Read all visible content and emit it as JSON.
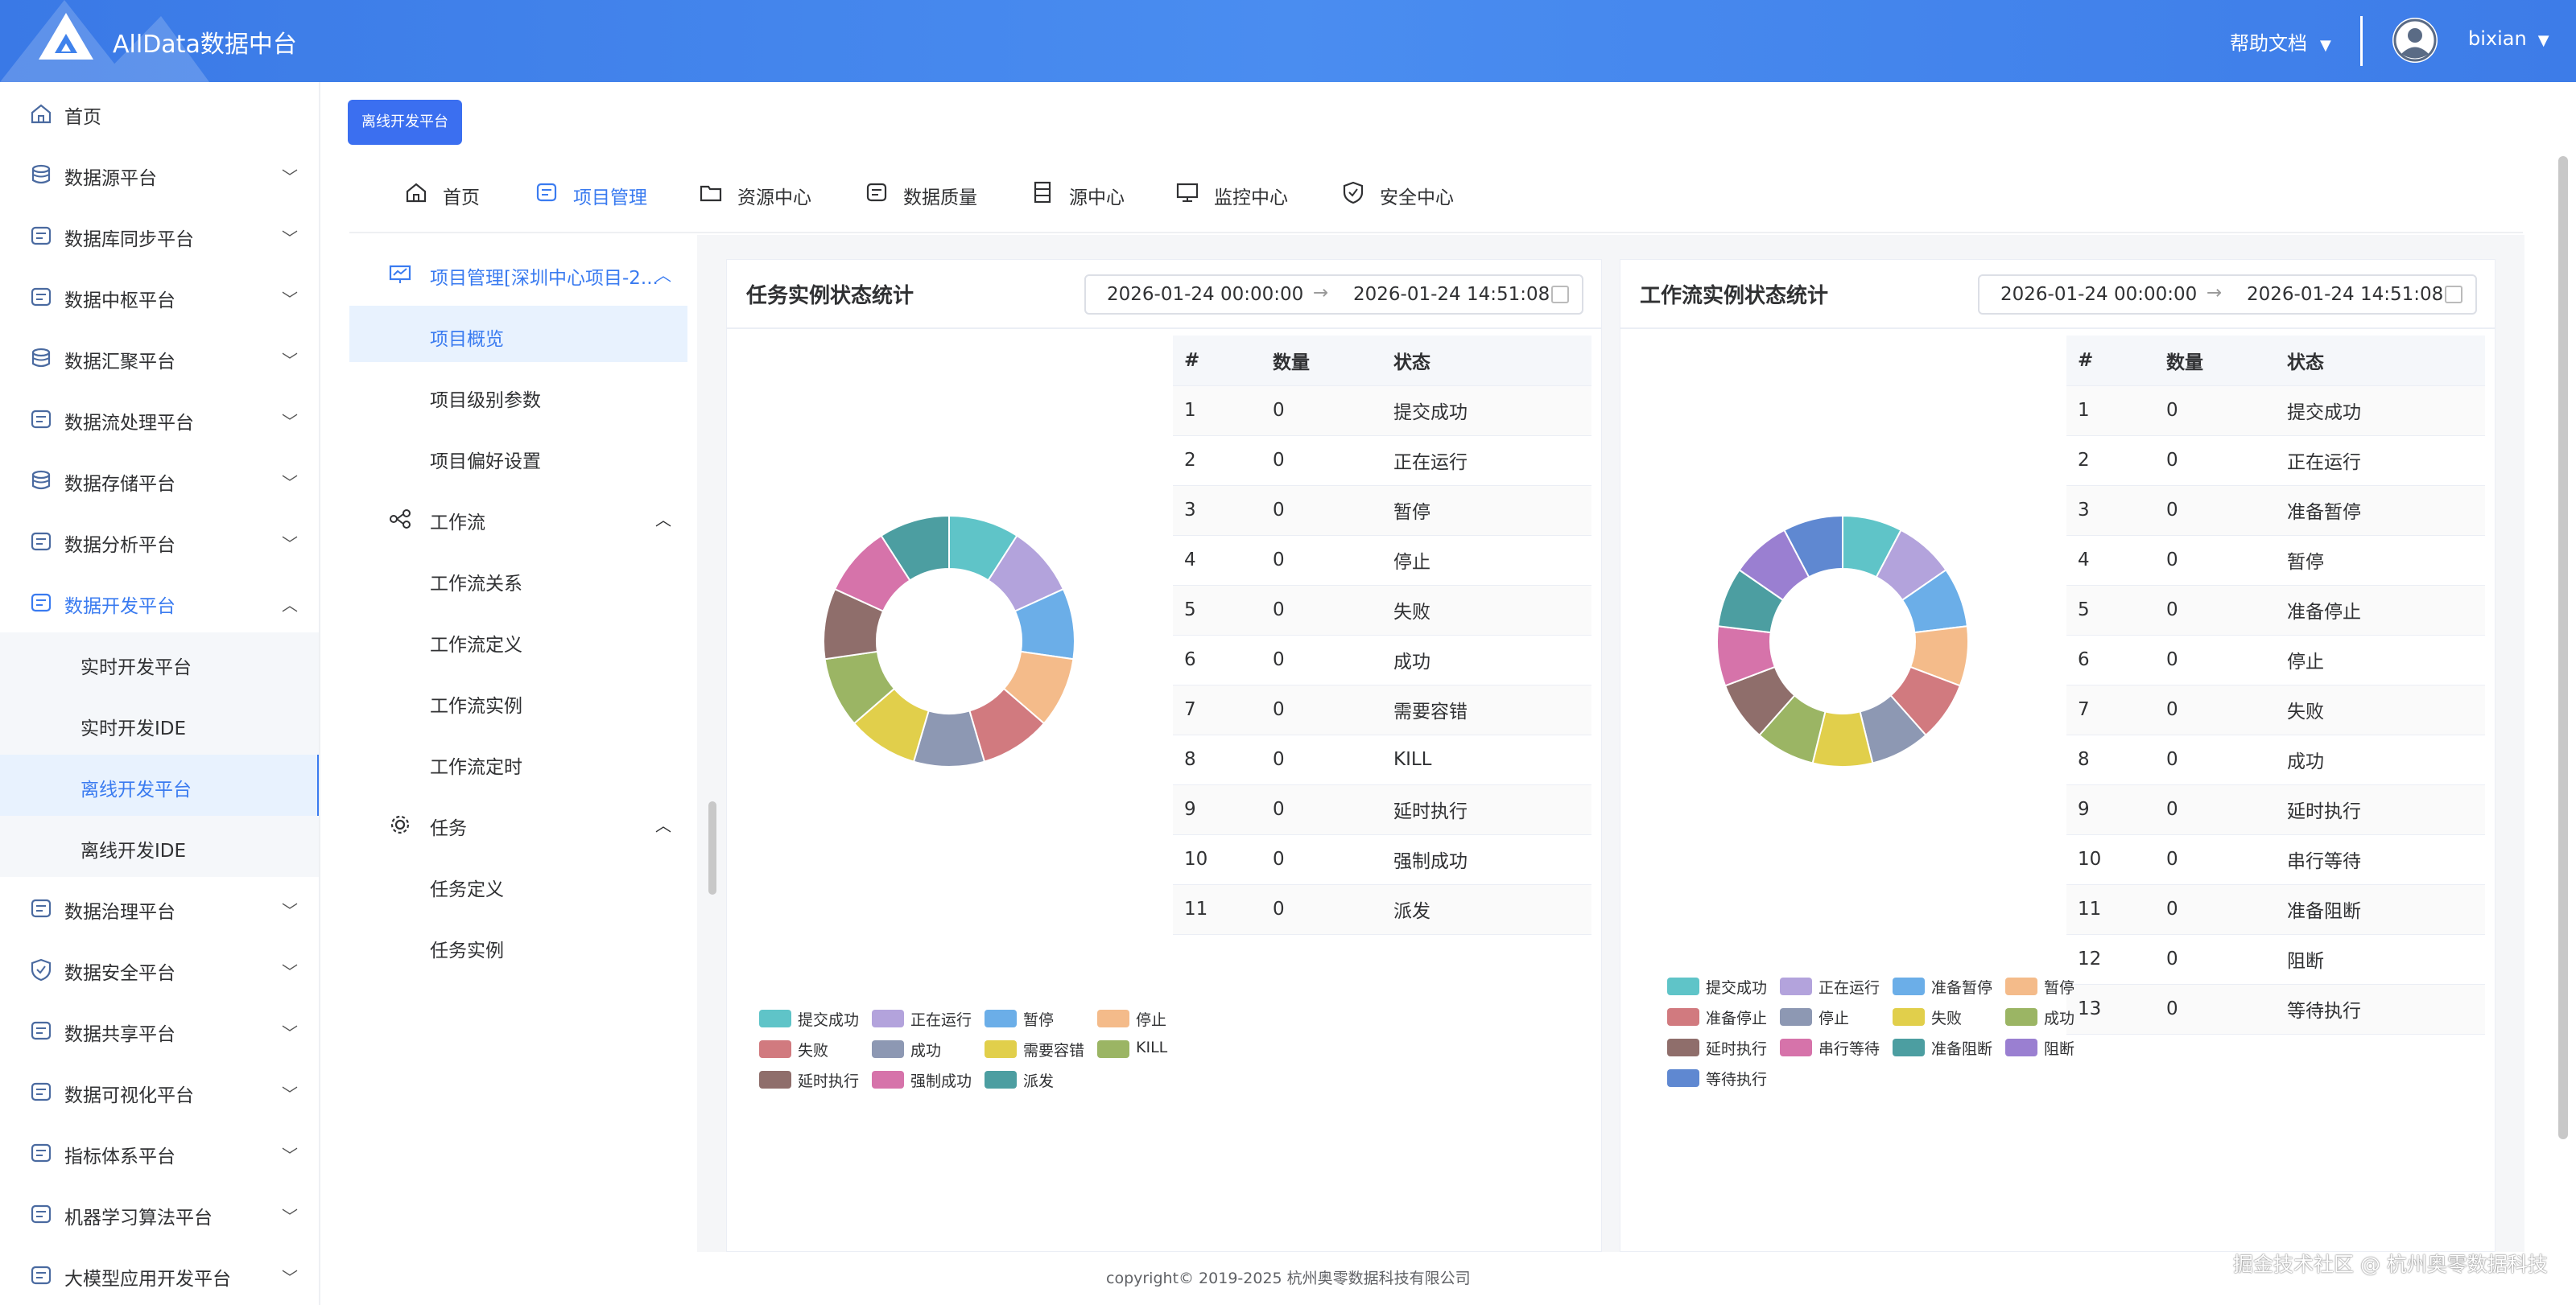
{
  "header": {
    "app_title": "AllData数据中台",
    "help_label": "帮助文档",
    "user_name": "bixian",
    "dropdown_glyph": "▼"
  },
  "sidebar": {
    "items": [
      {
        "label": "首页",
        "icon": "home-icon",
        "expandable": false
      },
      {
        "label": "数据源平台",
        "icon": "database-icon",
        "expandable": true
      },
      {
        "label": "数据库同步平台",
        "icon": "sync-icon",
        "expandable": true
      },
      {
        "label": "数据中枢平台",
        "icon": "hub-icon",
        "expandable": true
      },
      {
        "label": "数据汇聚平台",
        "icon": "layers-icon",
        "expandable": true
      },
      {
        "label": "数据流处理平台",
        "icon": "stream-icon",
        "expandable": true
      },
      {
        "label": "数据存储平台",
        "icon": "storage-icon",
        "expandable": true
      },
      {
        "label": "数据分析平台",
        "icon": "analysis-icon",
        "expandable": true
      },
      {
        "label": "数据开发平台",
        "icon": "dev-icon",
        "expandable": true,
        "open": true
      },
      {
        "label": "实时开发平台",
        "sub": true
      },
      {
        "label": "实时开发IDE",
        "sub": true
      },
      {
        "label": "离线开发平台",
        "sub": true,
        "active": true
      },
      {
        "label": "离线开发IDE",
        "sub": true
      },
      {
        "label": "数据治理平台",
        "icon": "governance-icon",
        "expandable": true
      },
      {
        "label": "数据安全平台",
        "icon": "security-icon",
        "expandable": true
      },
      {
        "label": "数据共享平台",
        "icon": "share-icon",
        "expandable": true
      },
      {
        "label": "数据可视化平台",
        "icon": "visual-icon",
        "expandable": true
      },
      {
        "label": "指标体系平台",
        "icon": "metrics-icon",
        "expandable": true
      },
      {
        "label": "机器学习算法平台",
        "icon": "ml-icon",
        "expandable": true
      },
      {
        "label": "大模型应用开发平台",
        "icon": "llm-icon",
        "expandable": true
      }
    ]
  },
  "top_button": "离线开发平台",
  "tabs": [
    {
      "label": "首页",
      "icon": "home-icon"
    },
    {
      "label": "项目管理",
      "icon": "project-icon",
      "active": true
    },
    {
      "label": "资源中心",
      "icon": "folder-icon"
    },
    {
      "label": "数据质量",
      "icon": "quality-icon"
    },
    {
      "label": "源中心",
      "icon": "source-icon"
    },
    {
      "label": "监控中心",
      "icon": "monitor-icon"
    },
    {
      "label": "安全中心",
      "icon": "shield-icon"
    }
  ],
  "tree": [
    {
      "label": "项目管理[深圳中心项目-2...",
      "type": "head",
      "active": true,
      "icon": "project-chart-icon"
    },
    {
      "label": "项目概览",
      "type": "sub",
      "selected": true
    },
    {
      "label": "项目级别参数",
      "type": "sub"
    },
    {
      "label": "项目偏好设置",
      "type": "sub"
    },
    {
      "label": "工作流",
      "type": "head",
      "icon": "workflow-icon"
    },
    {
      "label": "工作流关系",
      "type": "sub"
    },
    {
      "label": "工作流定义",
      "type": "sub"
    },
    {
      "label": "工作流实例",
      "type": "sub"
    },
    {
      "label": "工作流定时",
      "type": "sub"
    },
    {
      "label": "任务",
      "type": "head",
      "icon": "gear-icon"
    },
    {
      "label": "任务定义",
      "type": "sub"
    },
    {
      "label": "任务实例",
      "type": "sub"
    }
  ],
  "task_card": {
    "title": "任务实例状态统计",
    "date_start": "2026-01-24 00:00:00",
    "date_end": "2026-01-24 14:51:08",
    "arrow": "→",
    "columns": [
      "#",
      "数量",
      "状态"
    ],
    "rows": [
      [
        "1",
        "0",
        "提交成功"
      ],
      [
        "2",
        "0",
        "正在运行"
      ],
      [
        "3",
        "0",
        "暂停"
      ],
      [
        "4",
        "0",
        "停止"
      ],
      [
        "5",
        "0",
        "失败"
      ],
      [
        "6",
        "0",
        "成功"
      ],
      [
        "7",
        "0",
        "需要容错"
      ],
      [
        "8",
        "0",
        "KILL"
      ],
      [
        "9",
        "0",
        "延时执行"
      ],
      [
        "10",
        "0",
        "强制成功"
      ],
      [
        "11",
        "0",
        "派发"
      ]
    ],
    "legend": [
      "提交成功",
      "正在运行",
      "暂停",
      "停止",
      "失败",
      "成功",
      "需要容错",
      "KILL",
      "延时执行",
      "强制成功",
      "派发"
    ],
    "colors": [
      "#5fc4c8",
      "#b3a3dc",
      "#6baee8",
      "#f4bb8a",
      "#d17a7f",
      "#8d98b3",
      "#e1cf4b",
      "#9bb564",
      "#8f6e6b",
      "#d673aa",
      "#4c9ea1"
    ]
  },
  "workflow_card": {
    "title": "工作流实例状态统计",
    "date_start": "2026-01-24 00:00:00",
    "date_end": "2026-01-24 14:51:08",
    "arrow": "→",
    "columns": [
      "#",
      "数量",
      "状态"
    ],
    "rows": [
      [
        "1",
        "0",
        "提交成功"
      ],
      [
        "2",
        "0",
        "正在运行"
      ],
      [
        "3",
        "0",
        "准备暂停"
      ],
      [
        "4",
        "0",
        "暂停"
      ],
      [
        "5",
        "0",
        "准备停止"
      ],
      [
        "6",
        "0",
        "停止"
      ],
      [
        "7",
        "0",
        "失败"
      ],
      [
        "8",
        "0",
        "成功"
      ],
      [
        "9",
        "0",
        "延时执行"
      ],
      [
        "10",
        "0",
        "串行等待"
      ],
      [
        "11",
        "0",
        "准备阻断"
      ],
      [
        "12",
        "0",
        "阻断"
      ],
      [
        "13",
        "0",
        "等待执行"
      ]
    ],
    "legend": [
      "提交成功",
      "正在运行",
      "准备暂停",
      "暂停",
      "准备停止",
      "停止",
      "失败",
      "成功",
      "延时执行",
      "串行等待",
      "准备阻断",
      "阻断",
      "等待执行"
    ],
    "colors": [
      "#5fc4c8",
      "#b3a3dc",
      "#6baee8",
      "#f4bb8a",
      "#d17a7f",
      "#8d98b3",
      "#e1cf4b",
      "#9bb564",
      "#8f6e6b",
      "#d673aa",
      "#4c9ea1",
      "#9a7fd1",
      "#5f88d1"
    ]
  },
  "footer": "copyright© 2019-2025 杭州奥零数据科技有限公司",
  "watermark": "掘金技术社区 @ 杭州奥零数据科技"
}
